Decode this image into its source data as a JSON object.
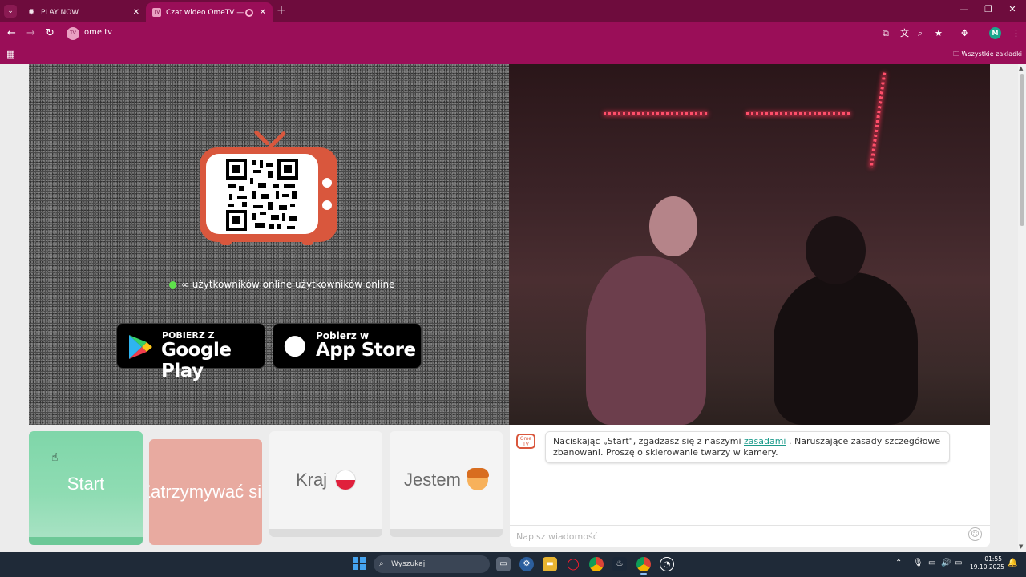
{
  "browser": {
    "tabs": [
      {
        "title": "PLAY NOW",
        "favicon": "eye-icon"
      },
      {
        "title": "Czat wideo OmeTV — alter",
        "favicon": "ometv-favicon",
        "recording": true
      }
    ],
    "new_tab": "+",
    "url": "ome.tv",
    "bookmarks_folder": "Wszystkie zakładki",
    "profile_initial": "M",
    "profile_color": "#1ba88e",
    "chrome_color": "#9a0e58",
    "tabstrip_color": "#6e0c3d"
  },
  "left_panel": {
    "online_text": "∞ użytkowników online użytkowników online",
    "google_play": {
      "small": "POBIERZ Z",
      "big": "Google Play"
    },
    "app_store": {
      "small": "Pobierz w",
      "big": "App Store"
    },
    "logo_color": "#d9573d"
  },
  "controls": {
    "start": "Start",
    "stop": "Zatrzymywać się",
    "country": "Kraj",
    "gender": "Jestem",
    "start_color": "#7fd6a9",
    "stop_color": "#e8aaa0"
  },
  "chat": {
    "logo": "Ome TV",
    "message_before": "Naciskając „Start\", zgadzasz się z naszymi ",
    "message_link": "zasadami",
    "message_after": " . Naruszające zasady szczegółowe zbanowani. Proszę o skierowanie twarzy w kamery.",
    "input_placeholder": "Napisz wiadomość"
  },
  "taskbar": {
    "search_placeholder": "Wyszukaj",
    "time": "01:55",
    "date": "19.10.2025"
  }
}
